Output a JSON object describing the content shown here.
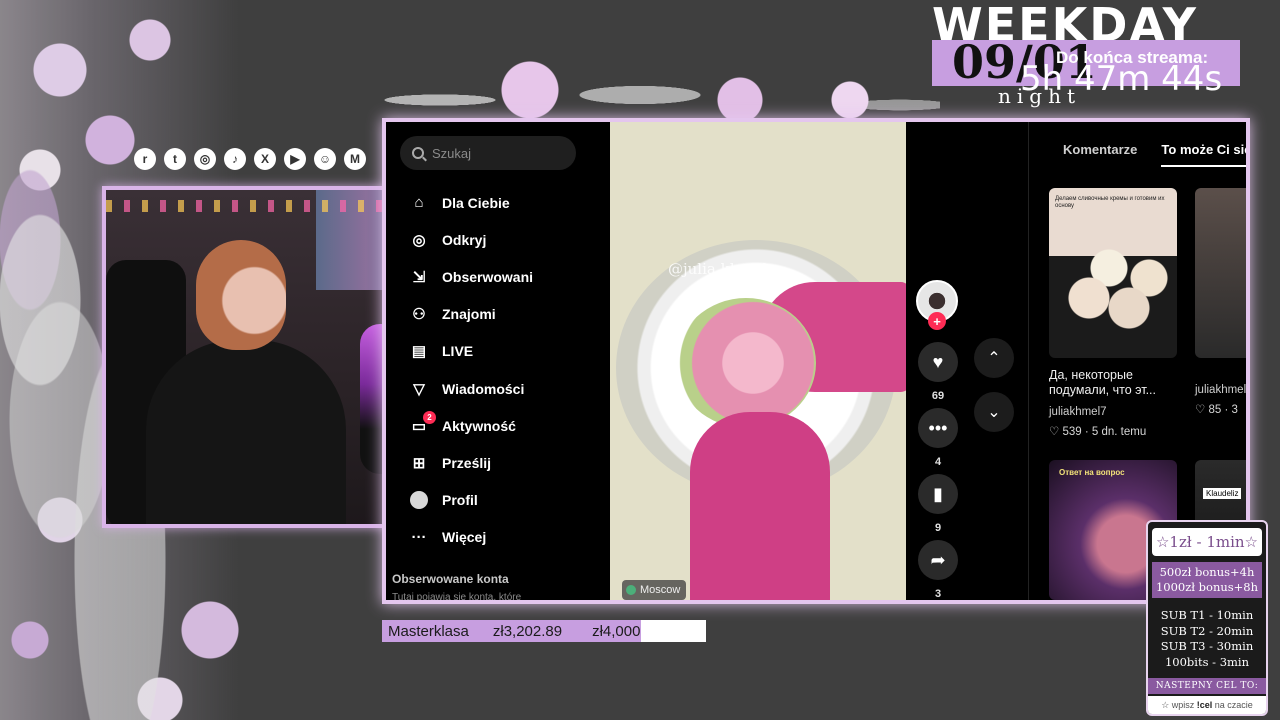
{
  "overlay": {
    "weekday_title": "WEEKDAY",
    "date": "09/01",
    "night": "night",
    "countdown_label": "Do końca streama:",
    "countdown_value": "5h 47m 44s",
    "socials": [
      "reddit-icon",
      "twitch-icon",
      "instagram-icon",
      "tiktok-icon",
      "x-icon",
      "youtube-icon",
      "discord-icon",
      "gmail-icon"
    ],
    "accent": "#c79ee0",
    "border": "#e4c6ee"
  },
  "tiktok": {
    "search_placeholder": "Szukaj",
    "nav": [
      {
        "label": "Dla Ciebie",
        "icon": "home-icon"
      },
      {
        "label": "Odkryj",
        "icon": "compass-icon"
      },
      {
        "label": "Obserwowani",
        "icon": "following-icon"
      },
      {
        "label": "Znajomi",
        "icon": "friends-icon"
      },
      {
        "label": "LIVE",
        "icon": "live-icon"
      },
      {
        "label": "Wiadomości",
        "icon": "send-icon"
      },
      {
        "label": "Aktywność",
        "icon": "inbox-icon",
        "badge": "2"
      },
      {
        "label": "Prześlij",
        "icon": "upload-icon"
      },
      {
        "label": "Profil",
        "icon": "profile-icon"
      },
      {
        "label": "Więcej",
        "icon": "more-icon"
      }
    ],
    "followed_heading": "Obserwowane konta",
    "followed_sub": "Tutaj pojawią się konta, które",
    "video": {
      "watermark": "@julia.khmel",
      "location": "Moscow"
    },
    "actions": {
      "likes": "69",
      "comments": "4",
      "saves": "9",
      "shares": "3"
    },
    "tabs": [
      "Komentarze",
      "To może Ci się"
    ],
    "cards": [
      {
        "caption": "Делаем сливочные кремы и готовим их основу",
        "title": "Да, некоторые подумали, что эт...",
        "author": "juliakhmel7",
        "meta": "♡ 539 · 5 dn. temu"
      },
      {
        "author": "juliakhmel",
        "meta": "♡ 85 · 3"
      }
    ],
    "card3_caption": "Ответ на вопрос",
    "card4_label": "Klaudeliz"
  },
  "goal": {
    "name": "Masterklasa",
    "current": "zł3,202.89",
    "target": "zł4,000",
    "progress": 0.8
  },
  "donate": {
    "rate": "☆1zł - 1min☆",
    "bonus_1": "500zł bonus+4h",
    "bonus_2": "1000zł bonus+8h",
    "subs": [
      "SUB T1 - 10min",
      "SUB T2 - 20min",
      "SUB T3 - 30min",
      "100bits - 3min"
    ],
    "next_goal": "NASTEPNY CEL TO:",
    "cmd_pre": "☆ wpisz ",
    "cmd": "!cel",
    "cmd_post": " na czacie"
  }
}
